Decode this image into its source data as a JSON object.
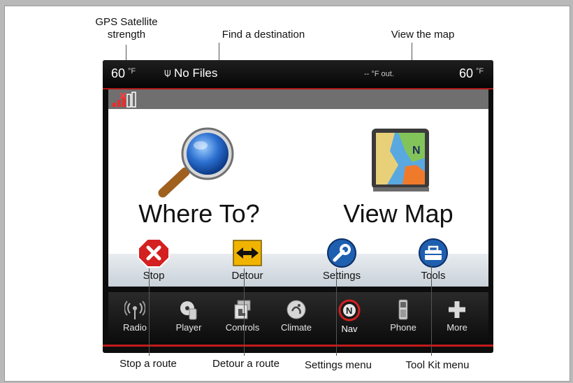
{
  "callouts": {
    "gps": "GPS Satellite\nstrength",
    "find": "Find a destination",
    "viewmap": "View the map",
    "stop": "Stop a route",
    "detour": "Detour a route",
    "settings": "Settings menu",
    "toolkit": "Tool Kit menu"
  },
  "status": {
    "left_temp": "60",
    "left_unit": "°F",
    "media": "No Files",
    "outside": "-- °F out.",
    "right_temp": "60",
    "right_unit": "°F"
  },
  "main": {
    "where_to": "Where To?",
    "view_map": "View Map"
  },
  "actions": [
    {
      "label": "Stop"
    },
    {
      "label": "Detour"
    },
    {
      "label": "Settings"
    },
    {
      "label": "Tools"
    }
  ],
  "dock": [
    {
      "label": "Radio"
    },
    {
      "label": "Player"
    },
    {
      "label": "Controls"
    },
    {
      "label": "Climate"
    },
    {
      "label": "Nav"
    },
    {
      "label": "Phone"
    },
    {
      "label": "More"
    }
  ],
  "colors": {
    "accent_red": "#c41a1a",
    "stop_red": "#d42020",
    "detour_yellow": "#f0b400",
    "settings_blue": "#1f5fb0"
  }
}
